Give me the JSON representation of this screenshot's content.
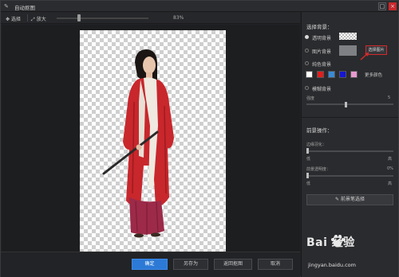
{
  "window": {
    "title": "自动抠图",
    "max_glyph": "□",
    "close_glyph": "×"
  },
  "toolbar": {
    "select_label": "选择",
    "zoom_label": "放大",
    "zoom_value": "83%",
    "zoom_level": 0.23
  },
  "actions": {
    "ok": "确定",
    "save_as": "另存为",
    "return": "返回抠图",
    "cancel": "取消"
  },
  "panel": {
    "bg_section_title": "选择背景：",
    "options": [
      {
        "label": "透明背景",
        "selected": true
      },
      {
        "label": "图片背景",
        "selected": false
      },
      {
        "label": "纯色背景",
        "selected": false
      },
      {
        "label": "模糊背景",
        "selected": false
      }
    ],
    "choose_image_button": "选择图片",
    "colors": [
      "#ffffff",
      "#e21d1d",
      "#3a8ad6",
      "#1515d6",
      "#e89ad0"
    ],
    "more_colors": "更多颜色",
    "blur_label": "强度",
    "blur_value": "5",
    "blur_level": 0.45,
    "fg_section_title": "前景操作：",
    "edge_label": "边缘羽化：",
    "edge_level": 0.0,
    "edge_low": "低",
    "edge_high": "高",
    "opacity_label": "前景透明度：",
    "opacity_value": "0%",
    "opacity_level": 0.0,
    "opacity_low": "低",
    "opacity_high": "高",
    "fg_brush_button": "前景笔选择"
  },
  "watermark": {
    "brand": "Bai 经验",
    "url": "jingyan.baidu.com"
  },
  "icons": {
    "app": "app-icon",
    "select": "select-icon",
    "zoom": "zoom-icon",
    "brush": "brush-icon",
    "paw": "baidu-paw-icon"
  }
}
